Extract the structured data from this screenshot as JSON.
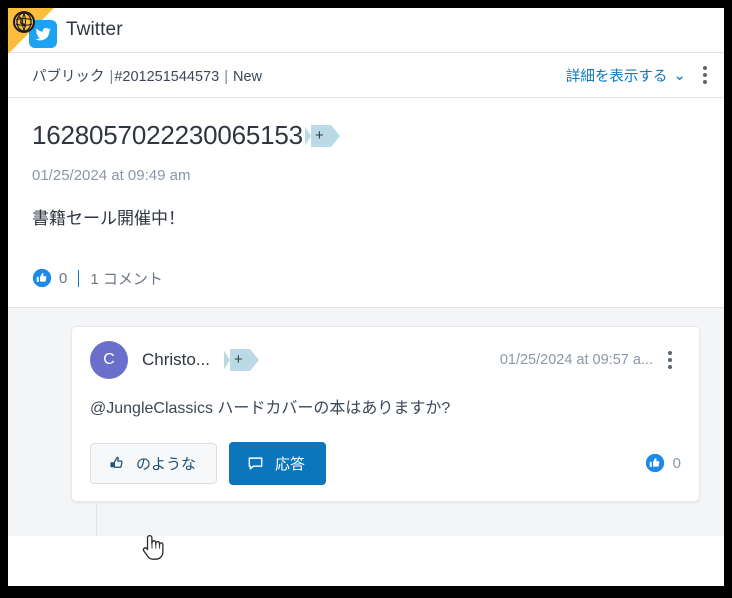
{
  "window": {
    "corner_badge_icon": "globe-icon",
    "app_icon": "twitter-bird-icon",
    "title": "Twitter",
    "accent_blue": "#1178bf",
    "brand_blue": "#1da1f2",
    "flag_yellow": "#fbbd3b",
    "reply_button_blue": "#0c76bc",
    "tag_badge_blue": "#bcd9e6",
    "avatar_purple": "#6b6fc9"
  },
  "subheader": {
    "visibility": "パブリック",
    "separator": "|",
    "case_id": "#201251544573",
    "status": "New",
    "details_label": "詳細を表示する",
    "details_chevron": "chevron-double-down-icon",
    "more_menu_icon": "kebab-menu-icon"
  },
  "post": {
    "title": "1628057022230065153",
    "tag_add_label": "+",
    "date": "01/25/2024 at 09:49 am",
    "text": "書籍セール開催中！",
    "like_icon": "thumbs-up-filled-icon",
    "like_count": "0",
    "comment_count_label": "1 コメント"
  },
  "comment": {
    "avatar_initial": "C",
    "author": "Christo...",
    "tag_add_label": "+",
    "timestamp": "01/25/2024 at 09:57 a...",
    "more_menu_icon": "kebab-menu-icon",
    "body": "@JungleClassics ハードカバーの本はありますか?",
    "like_button_label": "のような",
    "like_button_icon": "thumbs-up-outline-icon",
    "reply_button_label": "応答",
    "reply_button_icon": "speech-bubble-icon",
    "like_count_icon": "thumbs-up-filled-icon",
    "like_count": "0"
  },
  "cursor": {
    "type": "pointing-hand-cursor"
  }
}
